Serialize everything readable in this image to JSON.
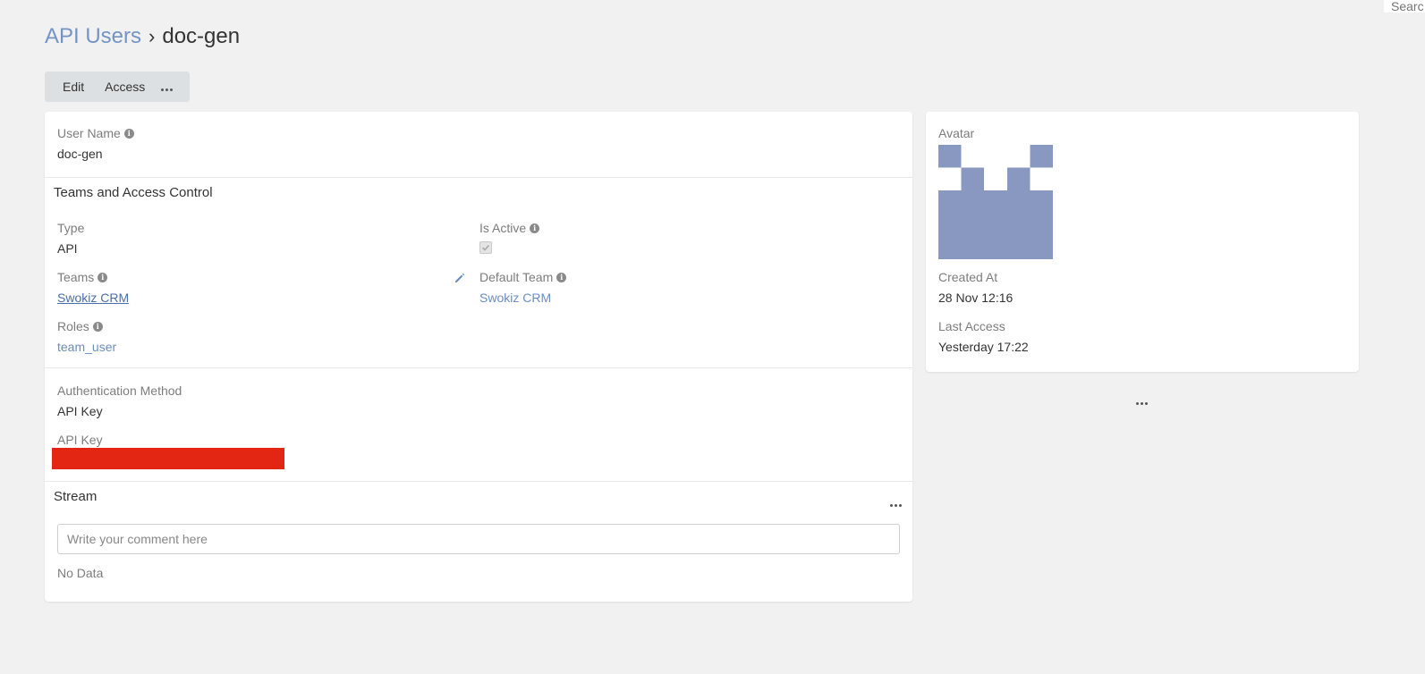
{
  "search": {
    "stub_text": "Searc"
  },
  "breadcrumb": {
    "parent": "API Users",
    "separator": "›",
    "current": "doc-gen"
  },
  "toolbar": {
    "edit_label": "Edit",
    "access_label": "Access"
  },
  "user_name": {
    "label": "User Name",
    "value": "doc-gen"
  },
  "teams_section": {
    "title": "Teams and Access Control",
    "type_label": "Type",
    "type_value": "API",
    "is_active_label": "Is Active",
    "is_active_checked": true,
    "teams_label": "Teams",
    "teams_value": "Swokiz CRM",
    "default_team_label": "Default Team",
    "default_team_value": "Swokiz CRM",
    "roles_label": "Roles",
    "roles_value": "team_user"
  },
  "auth_section": {
    "method_label": "Authentication Method",
    "method_value": "API Key",
    "api_key_label": "API Key"
  },
  "stream": {
    "title": "Stream",
    "comment_placeholder": "Write your comment here",
    "empty_text": "No Data"
  },
  "side": {
    "avatar_label": "Avatar",
    "created_label": "Created At",
    "created_value": "28 Nov 12:16",
    "last_access_label": "Last Access",
    "last_access_value": "Yesterday 17:22"
  },
  "colors": {
    "link": "#6b8ebf",
    "avatar": "#8898c0",
    "redacted": "#e32614",
    "background": "#f1f1f1"
  },
  "icons": {
    "info": "info-icon",
    "edit": "pencil-icon",
    "more": "ellipsis-icon",
    "check": "check-icon"
  }
}
